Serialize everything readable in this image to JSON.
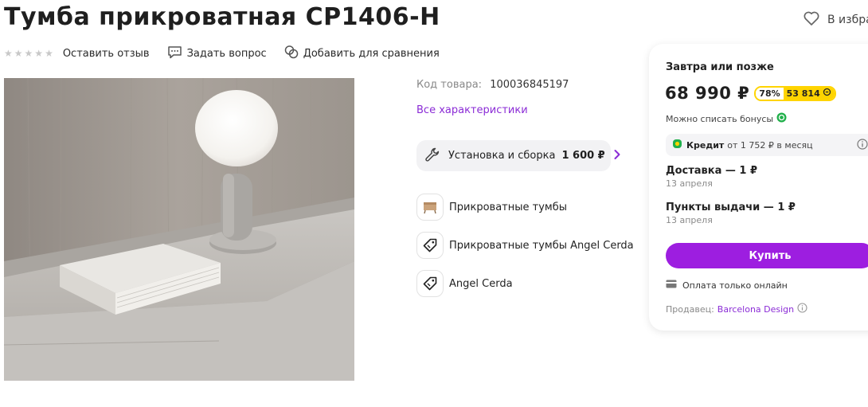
{
  "product": {
    "title": "Тумба прикроватная CP1406-H",
    "code_label": "Код товара:",
    "code_value": "100036845197",
    "all_characteristics": "Все характеристики",
    "image_icon": "product-photo-lamp-nightstand"
  },
  "header": {
    "favorite_label": "В избран",
    "favorite_icon": "heart-icon"
  },
  "actions": {
    "rating_stars": 5,
    "rating_value": 0,
    "review": "Оставить отзыв",
    "question": "Задать вопрос",
    "compare": "Добавить для сравнения"
  },
  "service": {
    "label": "Установка и сборка",
    "price": "1 600 ₽"
  },
  "categories": [
    {
      "label": "Прикроватные тумбы",
      "icon": "nightstand-icon"
    },
    {
      "label": "Прикроватные тумбы Angel Cerda",
      "icon": "tag-icon"
    },
    {
      "label": "Angel Cerda",
      "icon": "tag-icon"
    }
  ],
  "card": {
    "delivery_when": "Завтра или позже",
    "price": "68 990 ₽",
    "bonus_percent": "78%",
    "bonus_amount": "53 814",
    "can_write_off": "Можно списать бонусы",
    "credit_label": "Кредит",
    "credit_text": "от 1 752 ₽ в месяц",
    "delivery_title": "Доставка — 1 ₽",
    "delivery_date": "13 апреля",
    "pickup_title": "Пункты выдачи — 1 ₽",
    "pickup_date": "13 апреля",
    "buy": "Купить",
    "pay_online": "Оплата только онлайн",
    "seller_label": "Продавец:",
    "seller_name": "Barcelona Design"
  },
  "colors": {
    "accent": "#9d1ee0",
    "link": "#8b2cd6",
    "bonus": "#ffd400"
  }
}
